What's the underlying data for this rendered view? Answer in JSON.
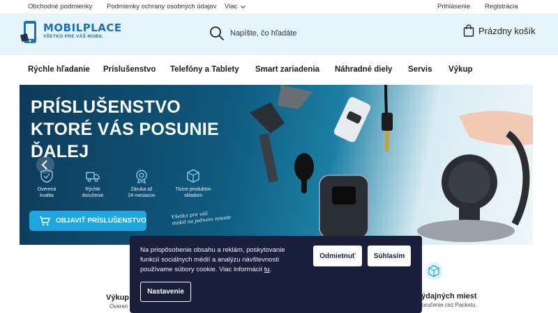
{
  "topbar": {
    "links": [
      "Obchodné podmienky",
      "Podmienky ochrany osobných údajov"
    ],
    "more_label": "Viac",
    "login": "Prihlásenie",
    "register": "Registrácia"
  },
  "header": {
    "logo_text": "MOBILPLACE",
    "logo_tagline": "VŠETKO PRE VÁŠ MOBIL",
    "search_placeholder": "Napíšte, čo hľadáte",
    "cart_label": "Prázdny košík"
  },
  "nav": {
    "items": [
      "Rýchle hľadanie",
      "Príslušenstvo",
      "Telefóny a Tablety",
      "Smart zariadenia",
      "Náhradné diely",
      "Servis",
      "Výkup"
    ]
  },
  "hero": {
    "title_lines": [
      "PRÍSLUŠENSTVO",
      "KTORÉ VÁS POSUNIE",
      "ĎALEJ"
    ],
    "features": [
      {
        "line1": "Overená",
        "line2": "kvalita",
        "icon": "shield-check-icon"
      },
      {
        "line1": "Rýchle",
        "line2": "doručenie",
        "icon": "truck-icon"
      },
      {
        "line1": "Záruka až",
        "line2": "24 mesiacov",
        "icon": "badge-icon"
      },
      {
        "line1": "Tisíce produktov",
        "line2": "skladom",
        "icon": "box-icon"
      }
    ],
    "cta_label": "OBJAVIŤ PRÍSLUŠENSTVO",
    "handwritten_line1": "Všetko pre váš",
    "handwritten_line2": "mobil na jednom mieste"
  },
  "below": {
    "left_title": "Výkup",
    "left_sub": "Overen",
    "right_title": "ýdajných miest",
    "right_sub": "oručenie cez Packetu."
  },
  "cookie": {
    "text": "Na prispôsobenie obsahu a reklám, poskytovanie funkcií sociálnych médií a analýzu návštevnosti používame súbory cookie. Viac informácií ",
    "link": "tu",
    "text_end": ".",
    "reject": "Odmietnuť",
    "accept": "Súhlasím",
    "settings": "Nastavenie"
  },
  "colors": {
    "header_bg": "#e6f4fb",
    "brand_blue": "#1d6fb8",
    "cta_blue": "#1ea6e0",
    "cookie_bg": "#1a1f3c"
  }
}
